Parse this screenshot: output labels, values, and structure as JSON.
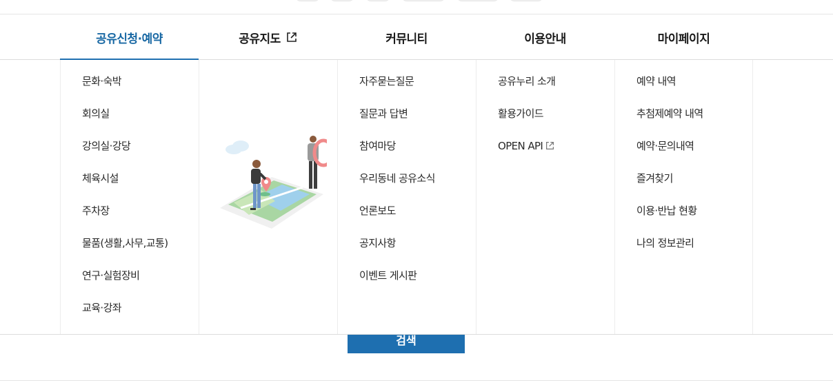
{
  "nav": {
    "tabs": [
      {
        "label": "공유신청·예약",
        "active": true
      },
      {
        "label": "공유지도",
        "external": true
      },
      {
        "label": "커뮤니티"
      },
      {
        "label": "이용안내"
      },
      {
        "label": "마이페이지"
      }
    ]
  },
  "menu": {
    "booking": [
      "문화·숙박",
      "회의실",
      "강의실·강당",
      "체육시설",
      "주차장",
      "물품(생활,사무,교통)",
      "연구·실험장비",
      "교육·강좌"
    ],
    "community": [
      "자주묻는질문",
      "질문과 답변",
      "참여마당",
      "우리동네 공유소식",
      "언론보도",
      "공지사항",
      "이벤트 게시판"
    ],
    "guide": [
      "공유누리 소개",
      "활용가이드",
      "OPEN API"
    ],
    "mypage": [
      "예약 내역",
      "추첨제예약 내역",
      "예약·문의내역",
      "즐겨찾기",
      "이용·반납 현황",
      "나의 정보관리"
    ]
  },
  "search": {
    "label": "검색"
  },
  "colors": {
    "accent": "#1767a3",
    "button": "#1e6fb0"
  },
  "icons": {
    "external": "external-link-icon"
  }
}
